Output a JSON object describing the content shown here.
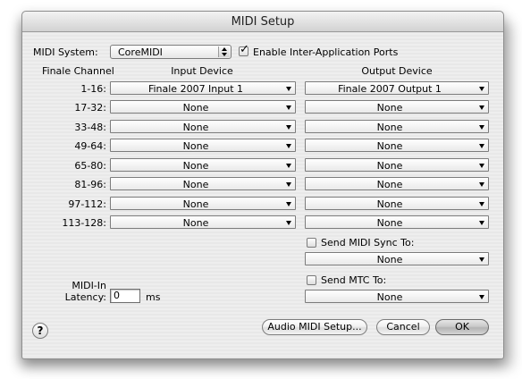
{
  "window": {
    "title": "MIDI Setup"
  },
  "midi_system": {
    "label": "MIDI System:",
    "value": "CoreMIDI"
  },
  "inter_app": {
    "label": "Enable Inter-Application Ports",
    "checked": true
  },
  "headers": {
    "channel": "Finale Channel",
    "input": "Input Device",
    "output": "Output Device"
  },
  "rows": [
    {
      "channel": "1-16:",
      "input": "Finale 2007 Input 1",
      "output": "Finale 2007 Output 1"
    },
    {
      "channel": "17-32:",
      "input": "None",
      "output": "None"
    },
    {
      "channel": "33-48:",
      "input": "None",
      "output": "None"
    },
    {
      "channel": "49-64:",
      "input": "None",
      "output": "None"
    },
    {
      "channel": "65-80:",
      "input": "None",
      "output": "None"
    },
    {
      "channel": "81-96:",
      "input": "None",
      "output": "None"
    },
    {
      "channel": "97-112:",
      "input": "None",
      "output": "None"
    },
    {
      "channel": "113-128:",
      "input": "None",
      "output": "None"
    }
  ],
  "sync": {
    "label": "Send MIDI Sync To:",
    "checked": false,
    "value": "None"
  },
  "mtc": {
    "label": "Send MTC To:",
    "checked": false,
    "value": "None"
  },
  "latency": {
    "label_line1": "MIDI-In",
    "label_line2": "Latency:",
    "value": "0",
    "unit": "ms"
  },
  "buttons": {
    "audio_midi": "Audio MIDI Setup...",
    "cancel": "Cancel",
    "ok": "OK",
    "help": "?"
  }
}
